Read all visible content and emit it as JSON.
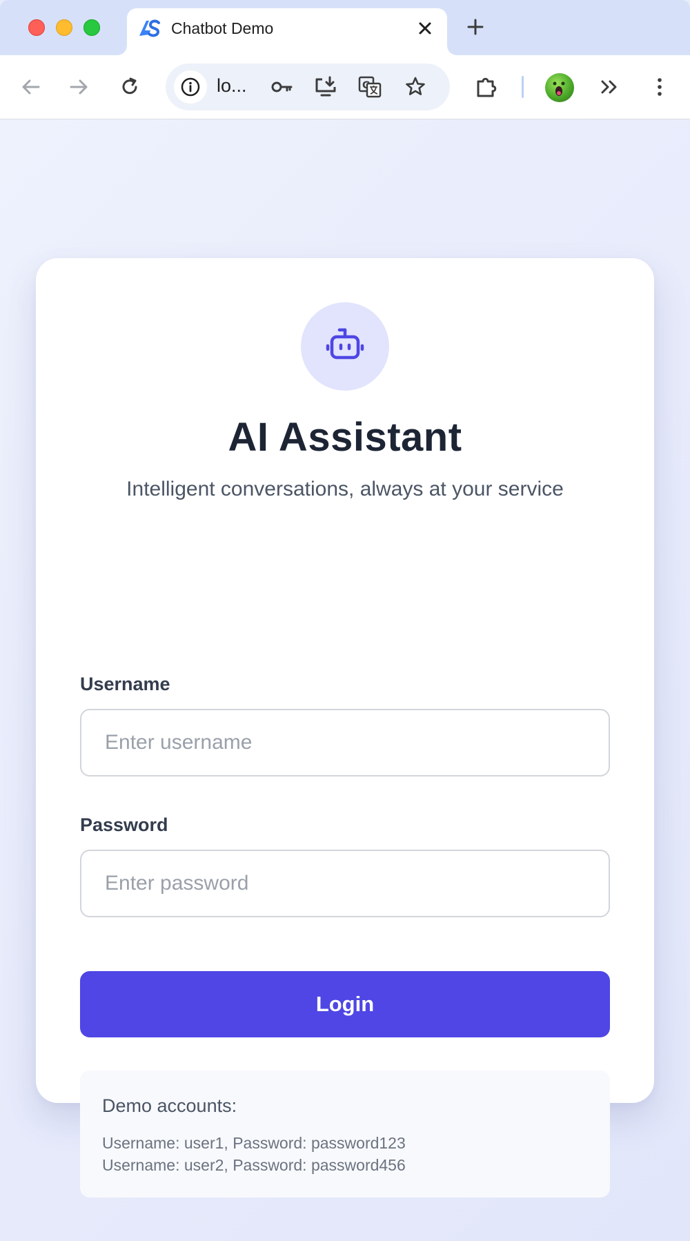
{
  "browser": {
    "tab": {
      "title": "Chatbot Demo"
    },
    "url": "lo..."
  },
  "login": {
    "title": "AI Assistant",
    "subtitle": "Intelligent conversations, always at your service",
    "username_label": "Username",
    "username_placeholder": "Enter username",
    "password_label": "Password",
    "password_placeholder": "Enter password",
    "login_button": "Login",
    "demo": {
      "title": "Demo accounts:",
      "accounts": [
        "Username: user1, Password: password123",
        "Username: user2, Password: password456"
      ]
    }
  },
  "colors": {
    "accent": "#4f46e5",
    "title": "#1d2535",
    "icon_bg": "#e1e4fc"
  }
}
